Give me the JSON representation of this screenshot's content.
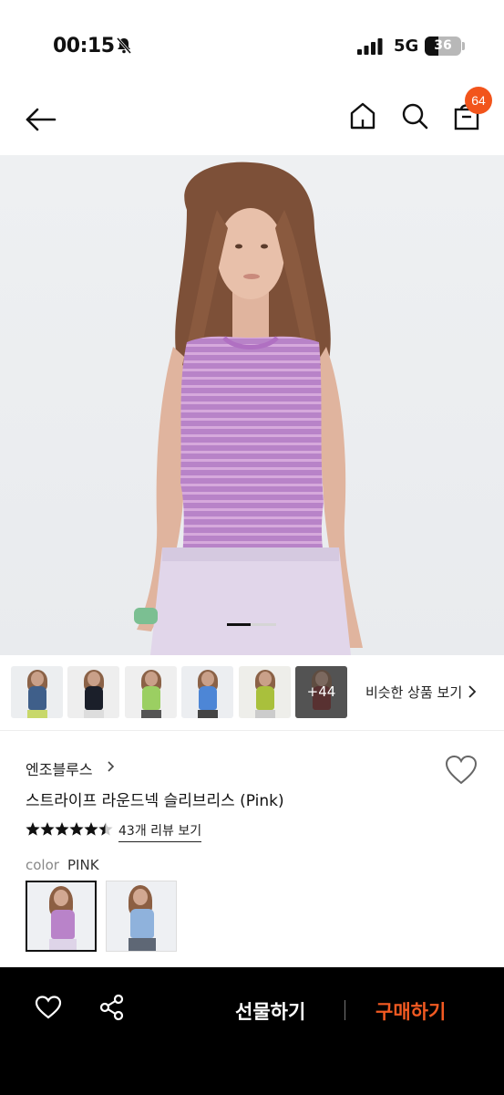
{
  "status_bar": {
    "time": "00:15",
    "network": "5G",
    "battery": "36"
  },
  "nav": {
    "cart_count": "64"
  },
  "thumbnails": {
    "more_count": "+44",
    "similar_label": "비슷한 상품 보기"
  },
  "product": {
    "brand": "엔조블루스",
    "title": "스트라이프 라운드넥 슬리브리스 (Pink)",
    "rating": 4.5,
    "review_link": "43개 리뷰 보기",
    "color_label": "color",
    "color_value": "PINK"
  },
  "bottom_bar": {
    "gift_label": "선물하기",
    "buy_label": "구매하기"
  },
  "colors": {
    "accent": "#f25a22",
    "badge": "#f2541b",
    "top_pink": "#b983c9"
  }
}
